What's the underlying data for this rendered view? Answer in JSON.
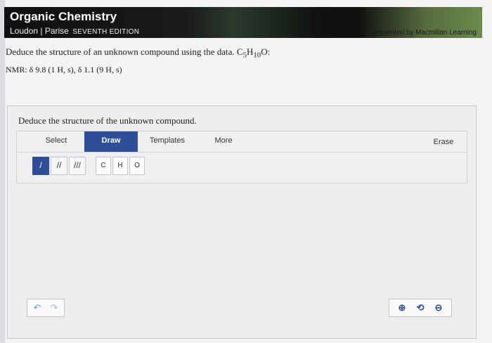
{
  "header": {
    "title": "Organic Chemistry",
    "authors": "Loudon | Parise",
    "edition": "SEVENTH EDITION",
    "presented": "presented by Macmillan Learning"
  },
  "question": {
    "text": "Deduce the structure of an unknown compound using the data.",
    "formula": {
      "c": "C",
      "c_sub": "5",
      "h": "H",
      "h_sub": "10",
      "o": "O:"
    },
    "nmr": "NMR: δ 9.8 (1 H, s), δ 1.1 (9 H, s)"
  },
  "editor": {
    "prompt": "Deduce the structure of the unknown compound.",
    "tabs": {
      "select": "Select",
      "draw": "Draw",
      "templates": "Templates",
      "more": "More",
      "erase": "Erase"
    },
    "bonds": {
      "single": "/",
      "double": "//",
      "triple": "///"
    },
    "atoms": [
      "C",
      "H",
      "O"
    ],
    "controls": {
      "undo": "↶",
      "redo": "↷",
      "zoom_in": "⊕",
      "reset": "⟲",
      "zoom_out": "⊖"
    }
  },
  "colors": {
    "accent": "#2d4e99",
    "banner": "#101010"
  }
}
